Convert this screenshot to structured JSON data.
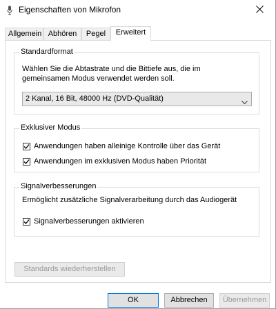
{
  "window": {
    "title": "Eigenschaften von Mikrofon"
  },
  "tabs": [
    {
      "label": "Allgemein"
    },
    {
      "label": "Abhören"
    },
    {
      "label": "Pegel"
    },
    {
      "label": "Erweitert"
    }
  ],
  "active_tab": "Erweitert",
  "standardformat": {
    "group_label": "Standardformat",
    "description_line1": "Wählen Sie die Abtastrate und die Bittiefe aus, die im",
    "description_line2": "gemeinsamen Modus verwendet werden soll.",
    "selected_format": "2 Kanal, 16 Bit, 48000 Hz (DVD-Qualität)"
  },
  "exklusiv": {
    "group_label": "Exklusiver Modus",
    "option1_label": "Anwendungen haben alleinige Kontrolle über das Gerät",
    "option1_checked": true,
    "option2_label": "Anwendungen im exklusiven Modus haben Priorität",
    "option2_checked": true
  },
  "signal": {
    "group_label": "Signalverbesserungen",
    "description": "Ermöglicht zusätzliche Signalverarbeitung durch das Audiogerät",
    "option_label": "Signalverbesserungen aktivieren",
    "option_checked": true
  },
  "buttons": {
    "restore_defaults": "Standards wiederherstellen",
    "ok": "OK",
    "cancel": "Abbrechen",
    "apply": "Übernehmen"
  }
}
